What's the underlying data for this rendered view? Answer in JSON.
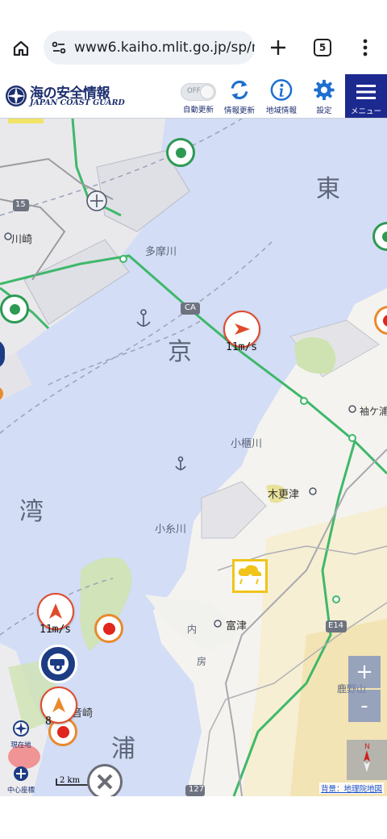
{
  "browser": {
    "url": "www6.kaiho.mlit.go.jp/sp/m",
    "tab_count": "5"
  },
  "app": {
    "title_jp": "海の安全情報",
    "title_en": "JAPAN COAST GUARD",
    "toggle_state": "OFF",
    "buttons": {
      "auto_update": "自動更新",
      "refresh": "情報更新",
      "area_info": "地域情報",
      "settings": "設定",
      "menu": "メニュー"
    }
  },
  "map": {
    "labels": {
      "tokyo_1": "東",
      "tokyo_2": "京",
      "bay": "湾",
      "ura": "浦",
      "tamagawa": "多摩川",
      "obitsugawa": "小櫃川",
      "koitogawa": "小糸川",
      "kawasaki": "川崎",
      "kisarazu": "木更津",
      "futtsu": "富津",
      "kannonzaki": "観音崎",
      "sodegaura": "袖ケ浦",
      "ca": "CA",
      "e14": "E14",
      "r15": "15",
      "r127": "127",
      "uchibo": "内",
      "bo": "房",
      "kanozan": "鹿野山"
    },
    "wind_readings": [
      {
        "label": "11m/s"
      },
      {
        "label": "11m/s"
      },
      {
        "label": "8"
      }
    ],
    "controls": {
      "zoom_in": "+",
      "zoom_out": "-",
      "current_location": "現在地",
      "center_coords": "中心座標",
      "scale": "2 km",
      "credit": "背景：地理院地図"
    },
    "colors": {
      "sea": "#d3ddf6",
      "land": "#f4f4f2",
      "accent": "#1c2a8f",
      "rail": "#3fb86a",
      "wind_marker": "#e04a2a"
    }
  }
}
